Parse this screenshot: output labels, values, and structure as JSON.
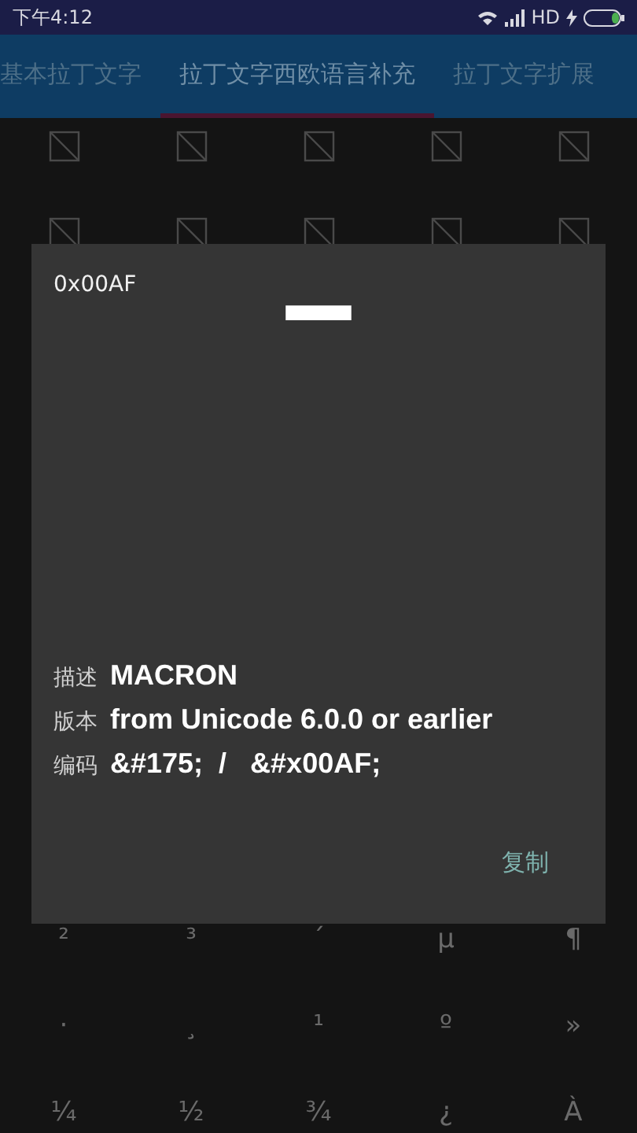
{
  "status_bar": {
    "time": "下午4:12",
    "network": "HD"
  },
  "tabs": [
    {
      "label": "基本拉丁文字",
      "selected": false
    },
    {
      "label": "拉丁文字西欧语言补充",
      "selected": true
    },
    {
      "label": "拉丁文字扩展",
      "selected": false
    }
  ],
  "grid_top": [
    {
      "kind": "missing"
    },
    {
      "kind": "missing"
    },
    {
      "kind": "missing"
    },
    {
      "kind": "missing"
    },
    {
      "kind": "missing"
    },
    {
      "kind": "missing"
    },
    {
      "kind": "missing"
    },
    {
      "kind": "missing"
    },
    {
      "kind": "missing"
    },
    {
      "kind": "missing"
    }
  ],
  "grid_bottom": [
    {
      "kind": "glyph",
      "char": "²"
    },
    {
      "kind": "glyph",
      "char": "³"
    },
    {
      "kind": "glyph",
      "char": "´"
    },
    {
      "kind": "glyph",
      "char": "µ"
    },
    {
      "kind": "glyph",
      "char": "¶"
    },
    {
      "kind": "glyph",
      "char": "·"
    },
    {
      "kind": "glyph",
      "char": "¸"
    },
    {
      "kind": "glyph",
      "char": "¹"
    },
    {
      "kind": "glyph",
      "char": "º"
    },
    {
      "kind": "glyph",
      "char": "»"
    },
    {
      "kind": "glyph",
      "char": "¼"
    },
    {
      "kind": "glyph",
      "char": "½"
    },
    {
      "kind": "glyph",
      "char": "¾"
    },
    {
      "kind": "glyph",
      "char": "¿"
    },
    {
      "kind": "glyph",
      "char": "À"
    }
  ],
  "dialog": {
    "code": "0x00AF",
    "glyph": "¯",
    "details": [
      {
        "label": "描述",
        "value": "MACRON"
      },
      {
        "label": "版本",
        "value": "from Unicode 6.0.0 or earlier"
      },
      {
        "label": "编码",
        "value": "&#175;  /   &#x00AF;"
      }
    ],
    "button": "复制"
  }
}
